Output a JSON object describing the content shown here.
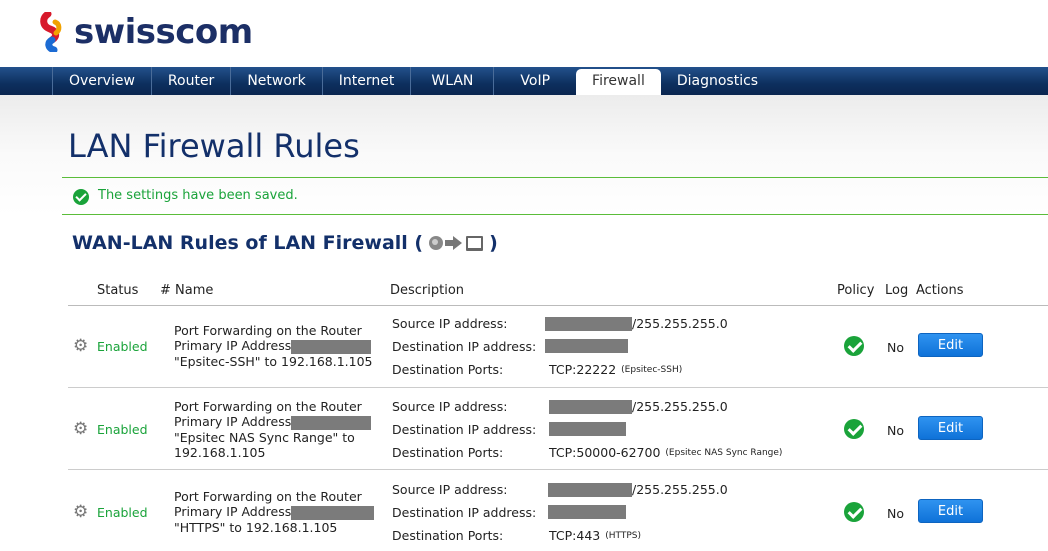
{
  "brand": {
    "name": "swisscom"
  },
  "nav": {
    "items": [
      {
        "label": "Overview"
      },
      {
        "label": "Router"
      },
      {
        "label": "Network"
      },
      {
        "label": "Internet"
      },
      {
        "label": "WLAN"
      },
      {
        "label": "VoIP"
      },
      {
        "label": "Firewall",
        "active": true
      },
      {
        "label": "Diagnostics"
      }
    ]
  },
  "page": {
    "title": "LAN Firewall Rules",
    "notice": "The settings have been saved.",
    "section_title_prefix": "WAN-LAN Rules of LAN Firewall (",
    "section_title_suffix": ")"
  },
  "table": {
    "headers": {
      "status": "Status",
      "name": "# Name",
      "description": "Description",
      "policy": "Policy",
      "log": "Log",
      "actions": "Actions"
    },
    "labels": {
      "source": "Source IP address:",
      "destination": "Destination IP address:",
      "ports": "Destination Ports:"
    },
    "rows": [
      {
        "status": "Enabled",
        "name_line1": "Port Forwarding on the Router",
        "name_line2": "Primary IP Address",
        "name_line3": "\"Epsitec-SSH\" to 192.168.1.105",
        "name_line4": "",
        "source_mask": "/255.255.255.0",
        "ports": "TCP:22222",
        "ports_note": "(Epsitec-SSH)",
        "log": "No",
        "action": "Edit"
      },
      {
        "status": "Enabled",
        "name_line1": "Port Forwarding on the Router",
        "name_line2": "Primary IP Address",
        "name_line3": "\"Epsitec NAS Sync Range\" to",
        "name_line4": "192.168.1.105",
        "source_mask": "/255.255.255.0",
        "ports": "TCP:50000-62700",
        "ports_note": "(Epsitec NAS Sync Range)",
        "log": "No",
        "action": "Edit"
      },
      {
        "status": "Enabled",
        "name_line1": "Port Forwarding on the Router",
        "name_line2": "Primary IP Address",
        "name_line3": "\"HTTPS\" to 192.168.1.105",
        "name_line4": "",
        "source_mask": "/255.255.255.0",
        "ports": "TCP:443",
        "ports_note": "(HTTPS)",
        "log": "No",
        "action": "Edit"
      }
    ]
  },
  "colors": {
    "brand_blue": "#1c2f66",
    "nav_blue": "#0d2f5e",
    "success_green": "#1aa33a",
    "button_blue": "#1a80e0"
  }
}
